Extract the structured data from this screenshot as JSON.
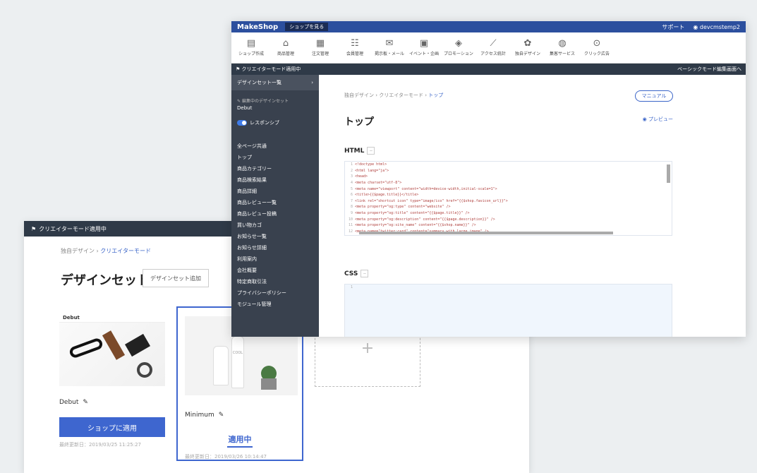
{
  "back": {
    "modebar": "クリエイターモード適用中",
    "breadcrumb": [
      "独自デザイン",
      "クリエイターモード"
    ],
    "title": "デザインセット一覧",
    "add_button": "デザインセット追加",
    "theme1": {
      "logo": "Debut",
      "name": "Debut",
      "apply": "ショップに適用",
      "updated": "最終更新日：2019/03/25 11:25:27"
    },
    "theme2": {
      "name": "Minimum",
      "bottle_text": "COOL",
      "status": "適用中",
      "updated": "最終更新日：2019/03/26 10:14:47"
    },
    "add_placeholder": "+"
  },
  "front": {
    "logo": "MakeShop",
    "shop_view": "ショップを見る",
    "support": "サポート",
    "user": "devcmstemp2",
    "menu": [
      {
        "label": "ショップ作成",
        "icon": "▤"
      },
      {
        "label": "商品管理",
        "icon": "⌂"
      },
      {
        "label": "注文管理",
        "icon": "▦"
      },
      {
        "label": "会員管理",
        "icon": "☷"
      },
      {
        "label": "掲示板・メール",
        "icon": "✉"
      },
      {
        "label": "イベント・企画",
        "icon": "▣"
      },
      {
        "label": "プロモーション",
        "icon": "◈"
      },
      {
        "label": "アクセス統計",
        "icon": "⟋"
      },
      {
        "label": "独自デザイン",
        "icon": "✿"
      },
      {
        "label": "集客サービス",
        "icon": "◍"
      },
      {
        "label": "クリック広告",
        "icon": "⊙"
      }
    ],
    "modebar": "クリエイターモード適用中",
    "modebar_right": "ベーシックモード編集画面へ",
    "sidenav": {
      "head": "デザインセット一覧",
      "editing_label": "編集中のデザインセット",
      "editing_name": "Debut",
      "responsive": "レスポンシブ",
      "items": [
        "全ページ共通",
        "トップ",
        "商品カテゴリー",
        "商品検索結果",
        "商品詳細",
        "商品レビュー一覧",
        "商品レビュー投稿",
        "買い物カゴ",
        "お知らせ一覧",
        "お知らせ詳細",
        "利用案内",
        "会社概要",
        "特定商取引法",
        "プライバシーポリシー",
        "モジュール管理"
      ]
    },
    "breadcrumb": [
      "独自デザイン",
      "クリエイターモード",
      "トップ"
    ],
    "manual": "マニュアル",
    "page_title": "トップ",
    "preview": "プレビュー",
    "html_label": "HTML",
    "css_label": "CSS",
    "html_code": [
      "<!doctype html>",
      "<html lang=\"ja\">",
      "<head>",
      "<meta charset=\"utf-8\">",
      "<meta name=\"viewport\" content=\"width=device-width,initial-scale=1\">",
      "<title>{{$page.title}}</title>",
      "<link rel=\"shortcut icon\" type=\"image/ico\" href=\"{{$shop.favicon_url}}\">",
      "<meta property=\"og:type\" content=\"website\" />",
      "<meta property=\"og:title\" content=\"{{$page.title}}\" />",
      "<meta property=\"og:description\" content=\"{{$page.description}}\" />",
      "<meta property=\"og:site_name\" content=\"{{$shop.name}}\" />",
      "<meta name=\"twitter:card\" content=\"summary_with_large_image\" />"
    ],
    "css_code": [
      ""
    ]
  }
}
